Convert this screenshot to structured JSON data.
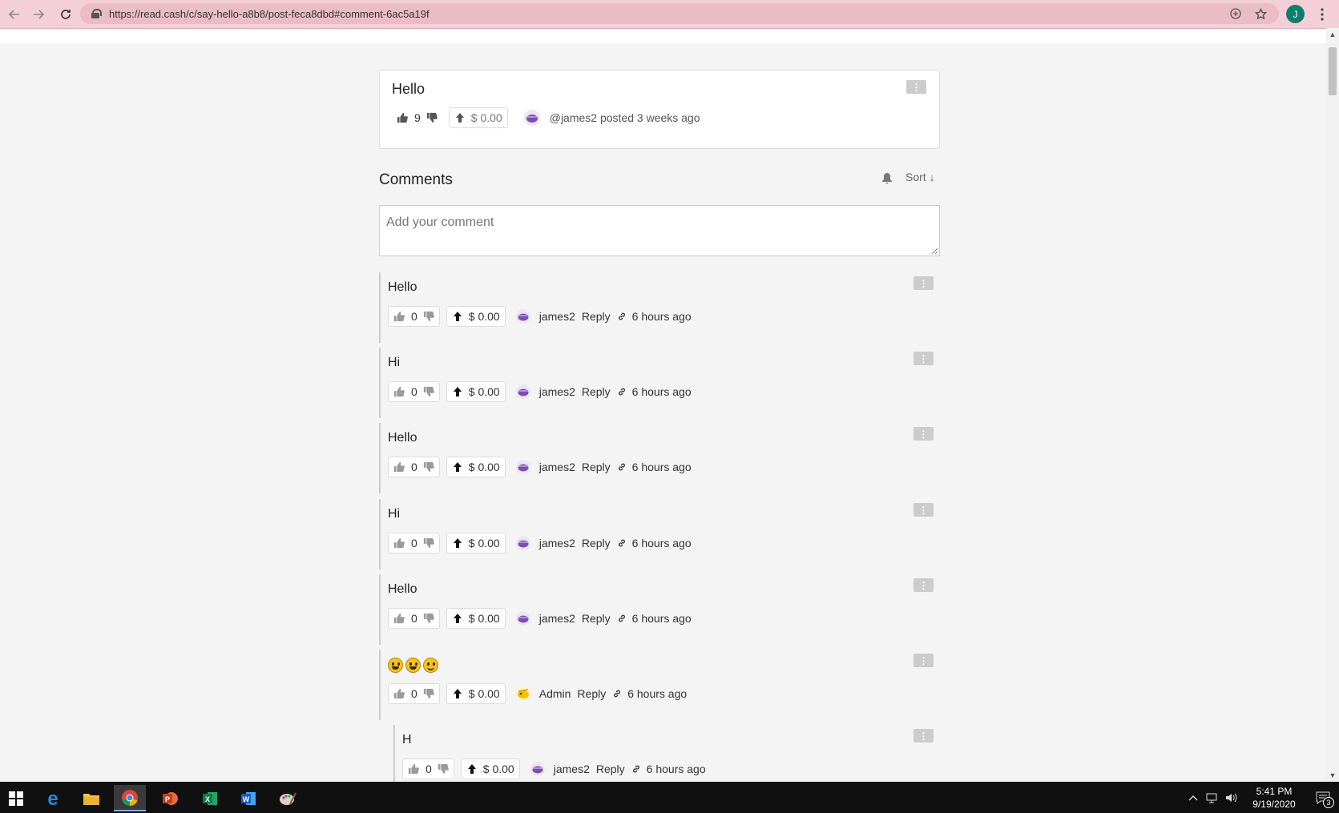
{
  "browser": {
    "url": "https://read.cash/c/say-hello-a8b8/post-feca8dbd#comment-6ac5a19f",
    "profile_initial": "J"
  },
  "post": {
    "title": "Hello",
    "votes": "9",
    "tip": "$ 0.00",
    "byline": "@james2 posted 3 weeks ago",
    "more_glyph": "⋮"
  },
  "comments_section": {
    "title": "Comments",
    "sort_label": "Sort ↓",
    "input_placeholder": "Add your comment"
  },
  "comments": [
    {
      "text": "Hello",
      "votes": "0",
      "tip": "$ 0.00",
      "author": "james2",
      "reply": "Reply",
      "time": "6 hours ago"
    },
    {
      "text": "Hi",
      "votes": "0",
      "tip": "$ 0.00",
      "author": "james2",
      "reply": "Reply",
      "time": "6 hours ago"
    },
    {
      "text": "Hello",
      "votes": "0",
      "tip": "$ 0.00",
      "author": "james2",
      "reply": "Reply",
      "time": "6 hours ago"
    },
    {
      "text": "Hi",
      "votes": "0",
      "tip": "$ 0.00",
      "author": "james2",
      "reply": "Reply",
      "time": "6 hours ago"
    },
    {
      "text": "Hello",
      "votes": "0",
      "tip": "$ 0.00",
      "author": "james2",
      "reply": "Reply",
      "time": "6 hours ago"
    },
    {
      "text": "",
      "votes": "0",
      "tip": "$ 0.00",
      "author": "Admin",
      "reply": "Reply",
      "time": "6 hours ago"
    },
    {
      "text": "H",
      "votes": "0",
      "tip": "$ 0.00",
      "author": "james2",
      "reply": "Reply",
      "time": "6 hours ago"
    }
  ],
  "taskbar": {
    "time": "5:41 PM",
    "date": "9/19/2020",
    "notification_count": "3"
  },
  "colors": {
    "browser_bar": "#f4cfd7",
    "omnibox": "#e9bcc6",
    "page_bg": "#f4f4f4",
    "profile_bg": "#0f7d6d",
    "avatar_purple": "#7b4fb3",
    "admin_avatar": "#f2c200"
  }
}
